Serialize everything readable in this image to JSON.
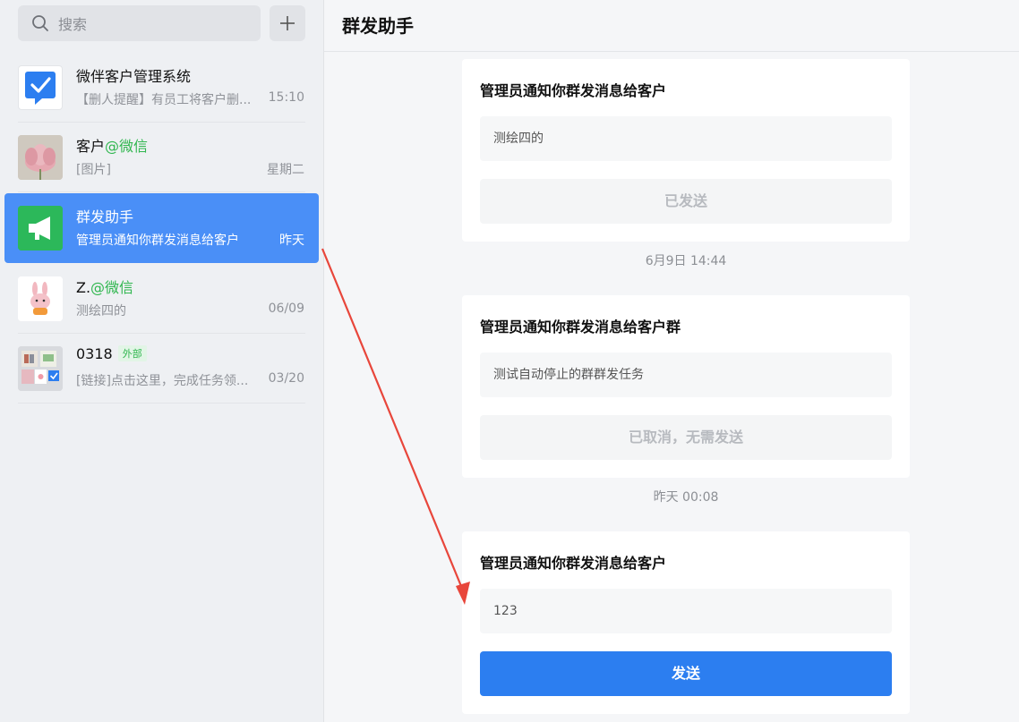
{
  "search": {
    "placeholder": "搜索"
  },
  "conversations": [
    {
      "name": "微伴客户管理系统",
      "preview": "【删人提醒】有员工将客户删...",
      "time": "15:10",
      "avatar": "check-chat-icon"
    },
    {
      "name": "客户",
      "suffix": "@微信",
      "preview": "[图片]",
      "time": "星期二",
      "avatar": "lotus-photo"
    },
    {
      "name": "群发助手",
      "preview": "管理员通知你群发消息给客户",
      "time": "昨天",
      "avatar": "megaphone-icon"
    },
    {
      "name": "Z.",
      "suffix": "@微信",
      "preview": "测绘四的",
      "time": "06/09",
      "avatar": "bunny-avatar"
    },
    {
      "name": "0318",
      "tag": "外部",
      "preview": "[链接]点击这里，完成任务领...",
      "time": "03/20",
      "avatar": "group-avatar"
    }
  ],
  "header": {
    "title": "群发助手"
  },
  "messages": [
    {
      "title": "管理员通知你群发消息给客户",
      "content": "测绘四的",
      "status": "已发送"
    },
    {
      "timestamp": "6月9日 14:44"
    },
    {
      "title": "管理员通知你群发消息给客户群",
      "content": "测试自动停止的群群发任务",
      "status": "已取消，无需发送"
    },
    {
      "timestamp": "昨天 00:08"
    },
    {
      "title": "管理员通知你群发消息给客户",
      "content": "123",
      "action": "发送"
    }
  ],
  "colors": {
    "accent": "#2c7ef0",
    "active_row": "#4a8ff7",
    "wechat_green": "#2fb64e",
    "arrow": "#e8463b"
  }
}
